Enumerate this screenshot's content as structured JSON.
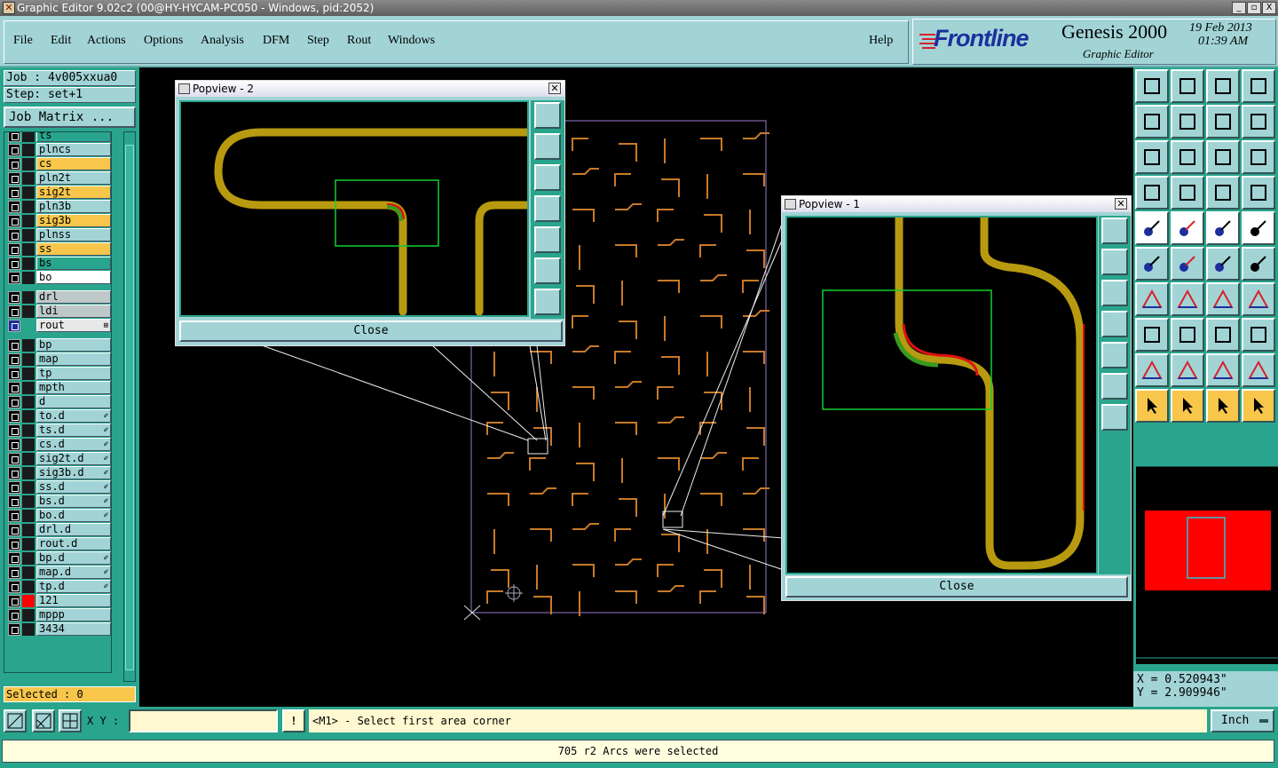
{
  "window": {
    "title": "Graphic Editor 9.02c2 (00@HY-HYCAM-PC050 - Windows, pid:2052)",
    "controls": [
      "_",
      "▫",
      "X"
    ]
  },
  "menu": {
    "items": [
      "File",
      "Edit",
      "Actions",
      "Options",
      "Analysis",
      "DFM",
      "Step",
      "Rout",
      "Windows"
    ],
    "help": "Help"
  },
  "brand": {
    "logo": "Frontline",
    "product": "Genesis 2000",
    "subtitle": "Graphic Editor",
    "date": "19 Feb 2013",
    "time": "01:39 AM"
  },
  "job": {
    "job_label": "Job : 4v005xxua0",
    "step_label": "Step: set+1",
    "matrix_button": "Job Matrix ..."
  },
  "layers": [
    {
      "name": "ts",
      "style": "grn",
      "tag": ""
    },
    {
      "name": "plncs",
      "style": "",
      "tag": ""
    },
    {
      "name": "cs",
      "style": "yel",
      "tag": ""
    },
    {
      "name": "pln2t",
      "style": "",
      "tag": ""
    },
    {
      "name": "sig2t",
      "style": "yel",
      "tag": ""
    },
    {
      "name": "pln3b",
      "style": "",
      "tag": ""
    },
    {
      "name": "sig3b",
      "style": "yel",
      "tag": ""
    },
    {
      "name": "plnss",
      "style": "",
      "tag": ""
    },
    {
      "name": "ss",
      "style": "yel",
      "tag": ""
    },
    {
      "name": "bs",
      "style": "grn",
      "tag": ""
    },
    {
      "name": "bo",
      "style": "wht",
      "tag": ""
    },
    {
      "name": "drl",
      "style": "gry",
      "tag": ""
    },
    {
      "name": "ldi",
      "style": "gry",
      "tag": ""
    },
    {
      "name": "rout",
      "style": "sel",
      "tag": "⊞"
    },
    {
      "name": "bp",
      "style": "",
      "tag": ""
    },
    {
      "name": "map",
      "style": "",
      "tag": ""
    },
    {
      "name": "tp",
      "style": "",
      "tag": ""
    },
    {
      "name": "mpth",
      "style": "",
      "tag": ""
    },
    {
      "name": "d",
      "style": "",
      "tag": ""
    },
    {
      "name": "to.d",
      "style": "",
      "tag": "✐"
    },
    {
      "name": "ts.d",
      "style": "",
      "tag": "✐"
    },
    {
      "name": "cs.d",
      "style": "",
      "tag": "✐"
    },
    {
      "name": "sig2t.d",
      "style": "",
      "tag": "✐"
    },
    {
      "name": "sig3b.d",
      "style": "",
      "tag": "✐"
    },
    {
      "name": "ss.d",
      "style": "",
      "tag": "✐"
    },
    {
      "name": "bs.d",
      "style": "",
      "tag": "✐"
    },
    {
      "name": "bo.d",
      "style": "",
      "tag": "✐"
    },
    {
      "name": "drl.d",
      "style": "",
      "tag": ""
    },
    {
      "name": "rout.d",
      "style": "",
      "tag": ""
    },
    {
      "name": "bp.d",
      "style": "",
      "tag": "✐"
    },
    {
      "name": "map.d",
      "style": "",
      "tag": "✐"
    },
    {
      "name": "tp.d",
      "style": "",
      "tag": "✐"
    },
    {
      "name": "121",
      "style": "",
      "tag": ""
    },
    {
      "name": "mppp",
      "style": "",
      "tag": ""
    },
    {
      "name": "3434",
      "style": "",
      "tag": ""
    }
  ],
  "selected_label": "Selected : 0",
  "popview2": {
    "title": "Popview - 2",
    "close": "Close"
  },
  "popview1": {
    "title": "Popview - 1",
    "close": "Close"
  },
  "coords": {
    "x": "X = 0.520943\"",
    "y": "Y = 2.909946\""
  },
  "bottom": {
    "xy_label": "X Y :",
    "xy_value": "",
    "bang": "!",
    "prompt": "<M1> - Select first area corner",
    "units": "Inch"
  },
  "status": "705 r2 Arcs were selected",
  "colors": {
    "panel": "#a2d4d6",
    "teal": "#2aa58d",
    "rout_trace": "#b89a10",
    "highlight": "#f7c64b",
    "zoom_box": "#00cc33"
  }
}
